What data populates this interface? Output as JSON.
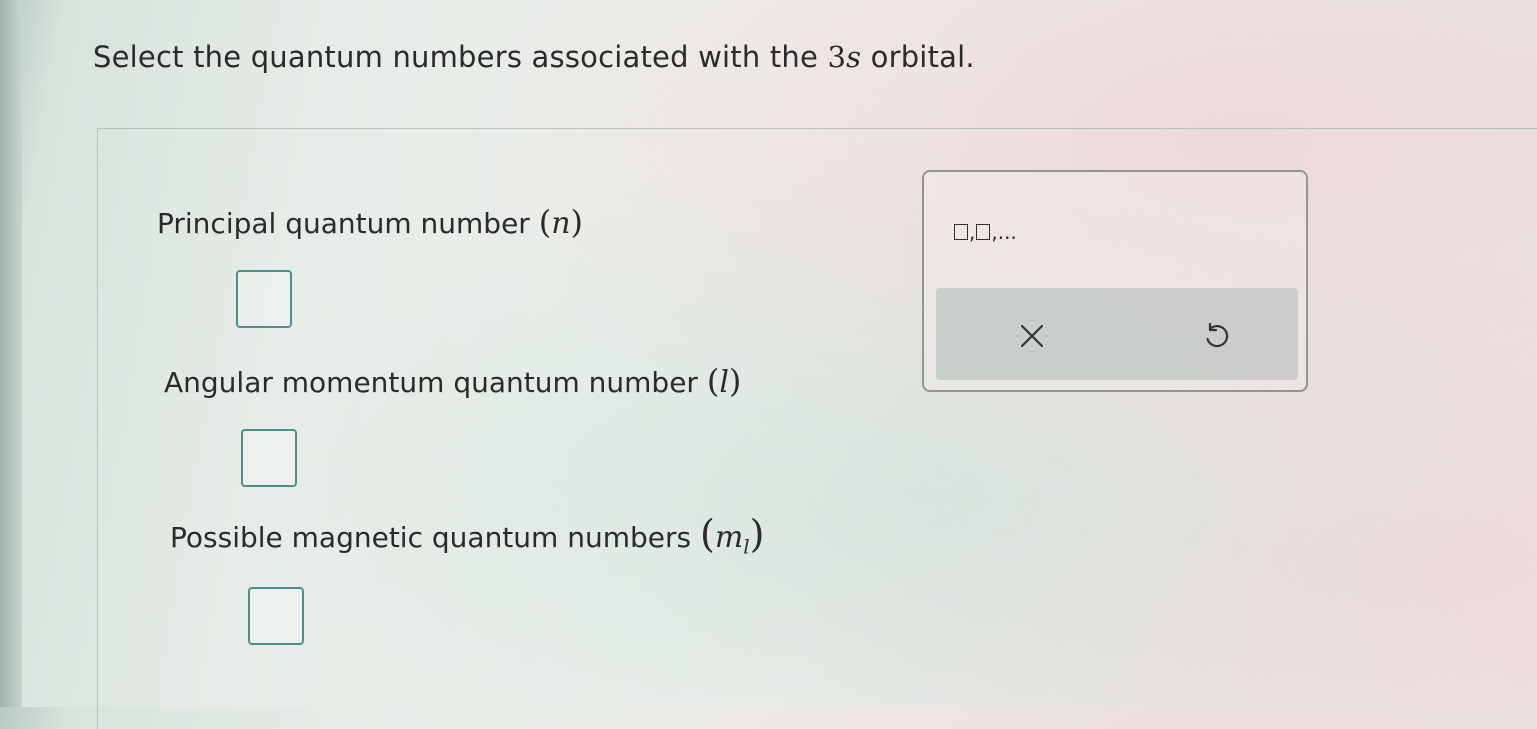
{
  "question": {
    "prefix": "Select the quantum numbers associated with the ",
    "orbital_num": "3",
    "orbital_letter": "s",
    "suffix": " orbital."
  },
  "fields": [
    {
      "label": "Principal quantum number ",
      "symbol": "n",
      "subscript": "",
      "value": ""
    },
    {
      "label": "Angular momentum quantum number ",
      "symbol": "l",
      "subscript": "",
      "value": ""
    },
    {
      "label": "Possible magnetic quantum numbers ",
      "symbol": "m",
      "subscript": "l",
      "value": ""
    }
  ],
  "palette": {
    "list_template_suffix": ",...",
    "list_template_sep": ",",
    "clear_icon": "x-icon",
    "undo_icon": "undo-icon"
  },
  "colors": {
    "answer_box_border": "#4d8f8a",
    "palette_border": "#8e9794",
    "action_bar": "#afb9b6"
  }
}
